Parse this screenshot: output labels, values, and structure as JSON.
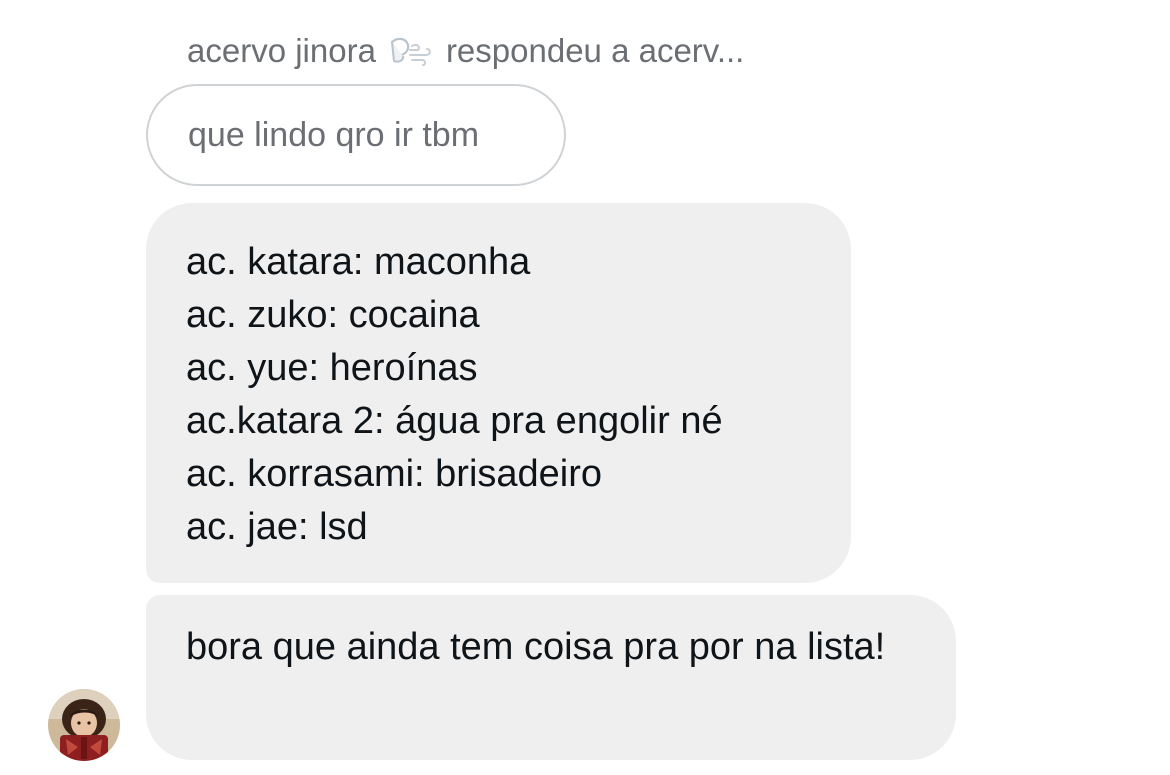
{
  "reply_context": {
    "author": "acervo jinora",
    "emoji_icon": "wind-face-icon",
    "action_text": "respondeu a acerv..."
  },
  "quoted_message": {
    "text": "que lindo qro ir tbm"
  },
  "messages": [
    {
      "lines": [
        "ac. katara: maconha",
        "ac. zuko: cocaina",
        "ac. yue: heroínas",
        "ac.katara 2: água pra engolir né",
        "ac. korrasami: brisadeiro",
        "ac. jae: lsd"
      ]
    },
    {
      "text": "bora que ainda tem coisa pra por na lista!"
    }
  ],
  "colors": {
    "bubble_background": "#efefef",
    "quoted_border": "#cfd3d6",
    "secondary_text": "#6b6f73",
    "primary_text": "#0f1419"
  }
}
